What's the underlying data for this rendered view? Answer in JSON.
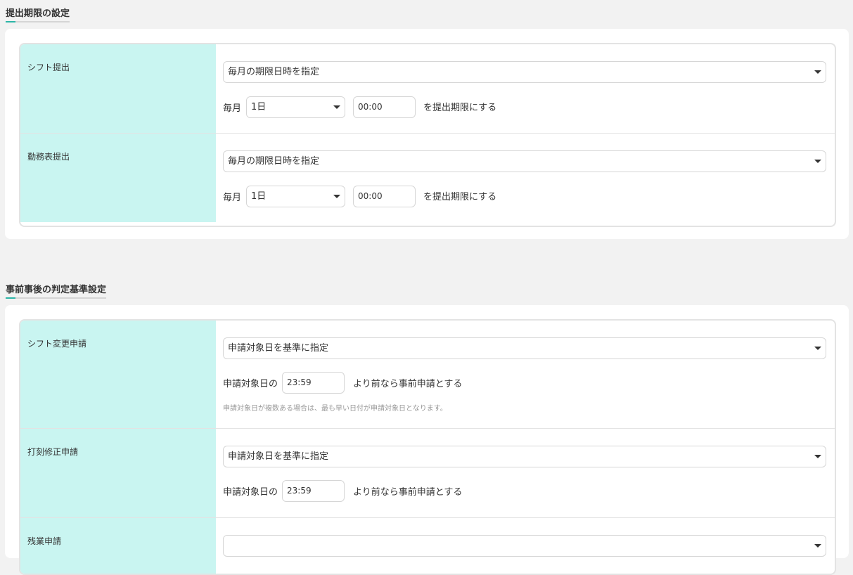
{
  "deadline_section": {
    "title": "提出期限の設定",
    "rows": [
      {
        "label": "シフト提出",
        "mode": "毎月の期限日時を指定",
        "prefix": "毎月",
        "day": "1日",
        "time": "00:00",
        "suffix": "を提出期限にする"
      },
      {
        "label": "勤務表提出",
        "mode": "毎月の期限日時を指定",
        "prefix": "毎月",
        "day": "1日",
        "time": "00:00",
        "suffix": "を提出期限にする"
      }
    ]
  },
  "judgement_section": {
    "title": "事前事後の判定基準設定",
    "rows": [
      {
        "label": "シフト変更申請",
        "mode": "申請対象日を基準に指定",
        "prefix": "申請対象日の",
        "time": "23:59",
        "suffix": "より前なら事前申請とする",
        "note": "申請対象日が複数ある場合は、最も早い日付が申請対象日となります。"
      },
      {
        "label": "打刻修正申請",
        "mode": "申請対象日を基準に指定",
        "prefix": "申請対象日の",
        "time": "23:59",
        "suffix": "より前なら事前申請とする"
      },
      {
        "label": "残業申請"
      }
    ]
  }
}
